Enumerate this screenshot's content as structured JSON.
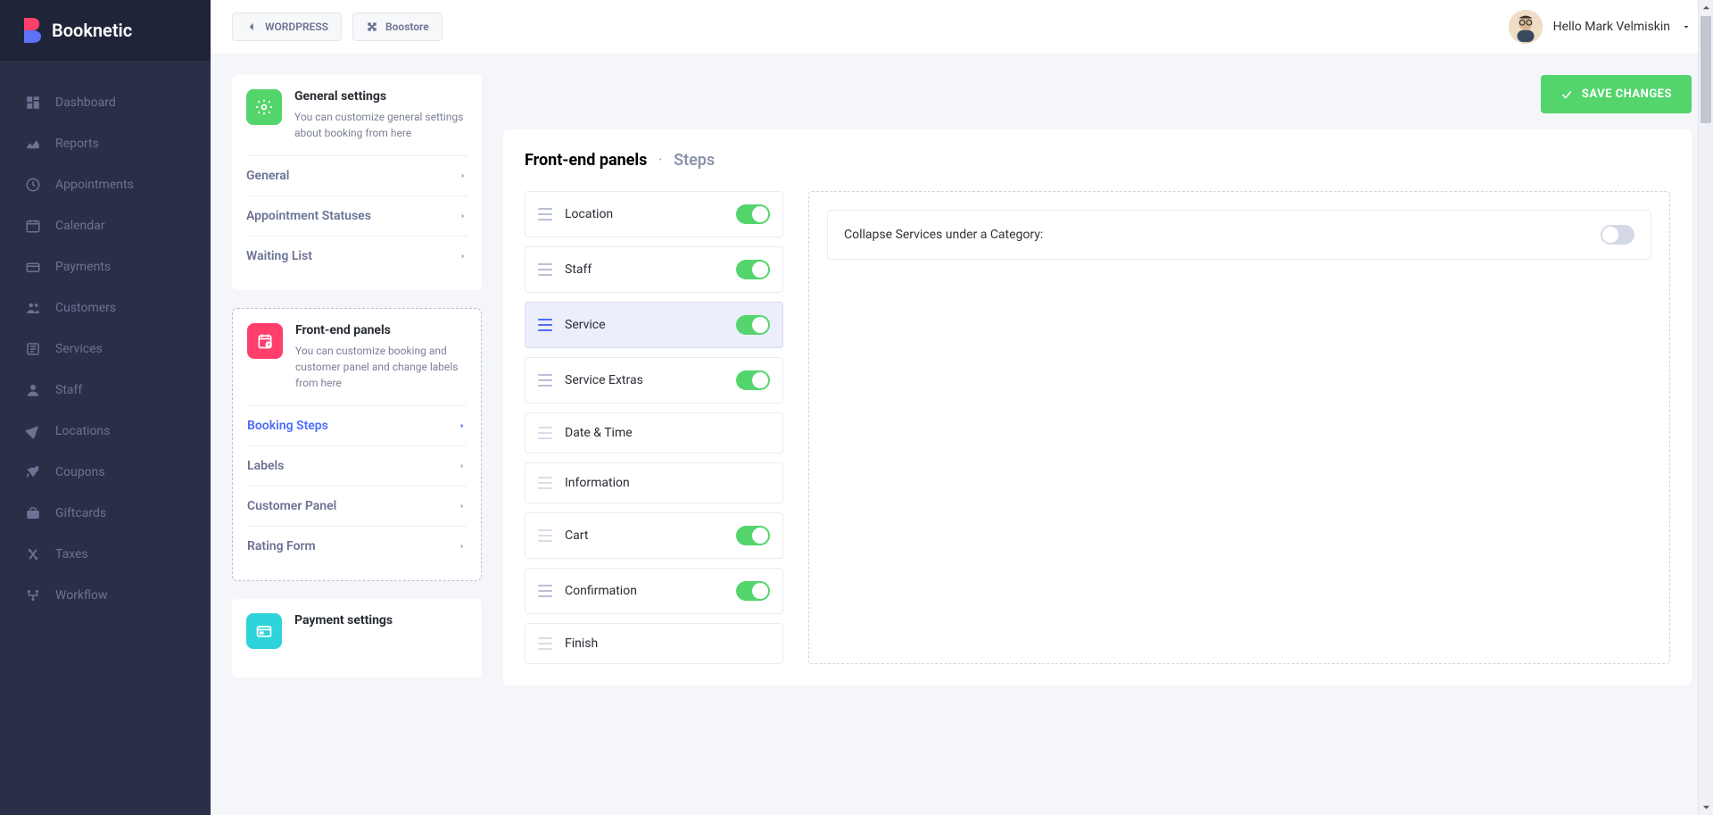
{
  "app": {
    "name": "Booknetic"
  },
  "topbar": {
    "wordpress_label": "WORDPRESS",
    "boostore_label": "Boostore",
    "greeting": "Hello Mark Velmiskin"
  },
  "nav": {
    "items": [
      {
        "label": "Dashboard"
      },
      {
        "label": "Reports"
      },
      {
        "label": "Appointments"
      },
      {
        "label": "Calendar"
      },
      {
        "label": "Payments"
      },
      {
        "label": "Customers"
      },
      {
        "label": "Services"
      },
      {
        "label": "Staff"
      },
      {
        "label": "Locations"
      },
      {
        "label": "Coupons"
      },
      {
        "label": "Giftcards"
      },
      {
        "label": "Taxes"
      },
      {
        "label": "Workflow"
      }
    ]
  },
  "settings_cards": [
    {
      "title": "General settings",
      "desc": "You can customize general settings about booking from here",
      "icon": "green",
      "links": [
        {
          "label": "General",
          "active": false
        },
        {
          "label": "Appointment Statuses",
          "active": false
        },
        {
          "label": "Waiting List",
          "active": false
        }
      ]
    },
    {
      "title": "Front-end panels",
      "desc": "You can customize booking and customer panel and change labels from here",
      "icon": "pink",
      "active": true,
      "links": [
        {
          "label": "Booking Steps",
          "active": true
        },
        {
          "label": "Labels",
          "active": false
        },
        {
          "label": "Customer Panel",
          "active": false
        },
        {
          "label": "Rating Form",
          "active": false
        }
      ]
    },
    {
      "title": "Payment settings",
      "desc": "",
      "icon": "cyan",
      "links": []
    }
  ],
  "save_label": "SAVE CHANGES",
  "breadcrumb": {
    "main": "Front-end panels",
    "sub": "Steps"
  },
  "steps": [
    {
      "label": "Location",
      "toggle": true
    },
    {
      "label": "Staff",
      "toggle": true
    },
    {
      "label": "Service",
      "toggle": true,
      "selected": true
    },
    {
      "label": "Service Extras",
      "toggle": true
    },
    {
      "label": "Date & Time",
      "toggle": false,
      "muted": true
    },
    {
      "label": "Information",
      "toggle": false,
      "muted": true
    },
    {
      "label": "Cart",
      "toggle": true,
      "muted": true
    },
    {
      "label": "Confirmation",
      "toggle": true
    },
    {
      "label": "Finish",
      "toggle": false,
      "muted": true
    }
  ],
  "option": {
    "label": "Collapse Services under a Category:"
  }
}
